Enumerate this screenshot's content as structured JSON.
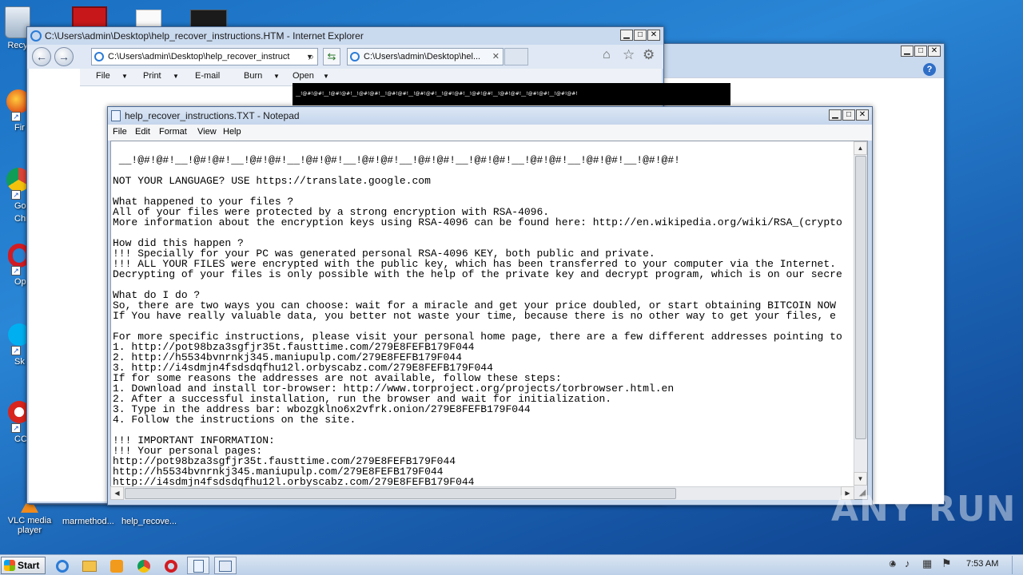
{
  "desktop": {
    "icons": {
      "recycle_bin": "Recy",
      "firefox": "Fir",
      "chrome_1": "Go",
      "chrome_2": "Chr",
      "opera": "Op",
      "skype": "Sk",
      "ccleaner": "CCl",
      "vlc_1": "VLC media",
      "vlc_2": "player",
      "marmethod": "marmethod...",
      "help_recover": "help_recove..."
    }
  },
  "ie_window": {
    "title": "C:\\Users\\admin\\Desktop\\help_recover_instructions.HTM - Internet Explorer",
    "address": "C:\\Users\\admin\\Desktop\\help_recover_instruct",
    "tab_label": "C:\\Users\\admin\\Desktop\\hel...",
    "commands": [
      "File",
      "Print",
      "E-mail",
      "Burn",
      "Open"
    ],
    "banner_text": "__!@#!@#!__!@#!@#!__!@#!@#!__!@#!@#!__!@#!@#!__!@#!@#!__!@#!@#!__!@#!@#!__!@#!@#!__!@#!@#!"
  },
  "notepad": {
    "title": "help_recover_instructions.TXT - Notepad",
    "menu": [
      "File",
      "Edit",
      "Format",
      "View",
      "Help"
    ],
    "lines": [
      "",
      " __!@#!@#!__!@#!@#!__!@#!@#!__!@#!@#!__!@#!@#!__!@#!@#!__!@#!@#!__!@#!@#!__!@#!@#!__!@#!@#!",
      "",
      "NOT YOUR LANGUAGE? USE https://translate.google.com",
      "",
      "What happened to your files ?",
      "All of your files were protected by a strong encryption with RSA-4096.",
      "More information about the encryption keys using RSA-4096 can be found here: http://en.wikipedia.org/wiki/RSA_(crypto",
      "",
      "How did this happen ?",
      "!!! Specially for your PC was generated personal RSA-4096 KEY, both public and private.",
      "!!! ALL YOUR FILES were encrypted with the public key, which has been transferred to your computer via the Internet.",
      "Decrypting of your files is only possible with the help of the private key and decrypt program, which is on our secre",
      "",
      "What do I do ?",
      "So, there are two ways you can choose: wait for a miracle and get your price doubled, or start obtaining BITCOIN NOW",
      "If You have really valuable data, you better not waste your time, because there is no other way to get your files, e",
      "",
      "For more specific instructions, please visit your personal home page, there are a few different addresses pointing to",
      "1. http://pot98bza3sgfjr35t.fausttime.com/279E8FEFB179F044",
      "2. http://h5534bvnrnkj345.maniupulp.com/279E8FEFB179F044",
      "3. http://i4sdmjn4fsdsdqfhu12l.orbyscabz.com/279E8FEFB179F044",
      "If for some reasons the addresses are not available, follow these steps:",
      "1. Download and install tor-browser: http://www.torproject.org/projects/torbrowser.html.en",
      "2. After a successful installation, run the browser and wait for initialization.",
      "3. Type in the address bar: wbozgklno6x2vfrk.onion/279E8FEFB179F044",
      "4. Follow the instructions on the site.",
      "",
      "!!! IMPORTANT INFORMATION:",
      "!!! Your personal pages:",
      "http://pot98bza3sgfjr35t.fausttime.com/279E8FEFB179F044",
      "http://h5534bvnrnkj345.maniupulp.com/279E8FEFB179F044",
      "http://i4sdmjn4fsdsdqfhu12l.orbyscabz.com/279E8FEFB179F044"
    ]
  },
  "taskbar": {
    "start_label": "Start",
    "time": "7:53 AM"
  },
  "watermark": "ANY RUN"
}
